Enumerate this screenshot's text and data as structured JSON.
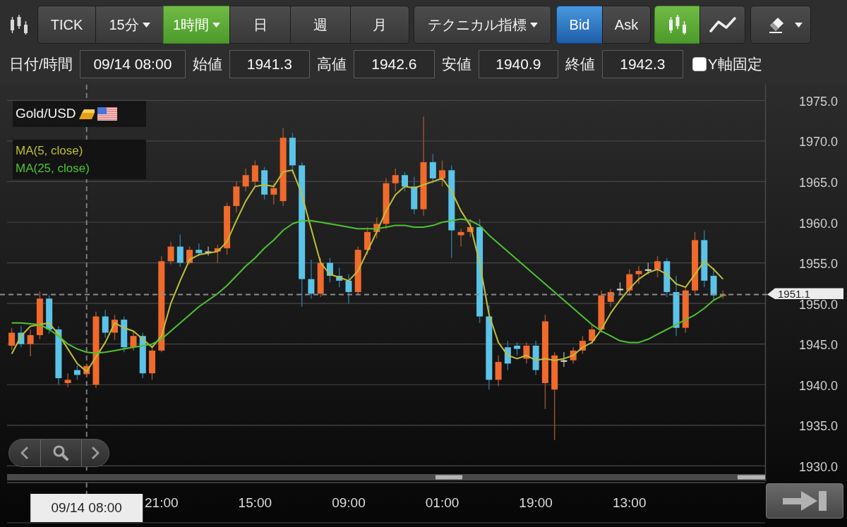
{
  "toolbar": {
    "periods": [
      {
        "label": "TICK",
        "selected": false,
        "dropdown": false
      },
      {
        "label": "15分",
        "selected": false,
        "dropdown": true
      },
      {
        "label": "1時間",
        "selected": true,
        "dropdown": true
      },
      {
        "label": "日",
        "selected": false,
        "dropdown": false
      },
      {
        "label": "週",
        "selected": false,
        "dropdown": false
      },
      {
        "label": "月",
        "selected": false,
        "dropdown": false
      }
    ],
    "indicator_menu": {
      "label": "テクニカル指標"
    },
    "price_sides": [
      {
        "label": "Bid",
        "selected": true
      },
      {
        "label": "Ask",
        "selected": false
      }
    ],
    "chart_types": [
      {
        "kind": "candlestick",
        "selected": true
      },
      {
        "kind": "line",
        "selected": false
      }
    ]
  },
  "ohlc_row": {
    "fields": [
      {
        "label": "日付/時間",
        "value": "09/14 08:00"
      },
      {
        "label": "始値",
        "value": "1941.3"
      },
      {
        "label": "高値",
        "value": "1942.6"
      },
      {
        "label": "安値",
        "value": "1940.9"
      },
      {
        "label": "終値",
        "value": "1942.3"
      }
    ],
    "y_axis_lock": {
      "label": "Y軸固定",
      "checked": false
    }
  },
  "chart": {
    "symbol": "Gold/USD",
    "crosshair_label": "09/14 08:00",
    "time_labels": [
      "21:00",
      "15:00",
      "09:00",
      "01:00",
      "19:00",
      "13:00"
    ],
    "chart_data": {
      "type": "candlestick",
      "grid": true,
      "ylim": [
        1930,
        1975
      ],
      "yticks": [
        {
          "value": 1975,
          "label": "1975.0"
        },
        {
          "value": 1970,
          "label": "1970.0"
        },
        {
          "value": 1965,
          "label": "1965.0"
        },
        {
          "value": 1960,
          "label": "1960.0"
        },
        {
          "value": 1955,
          "label": "1955.0"
        },
        {
          "value": 1950,
          "label": "1950.0"
        },
        {
          "value": 1945,
          "label": "1945.0"
        },
        {
          "value": 1940,
          "label": "1940.0"
        },
        {
          "value": 1935,
          "label": "1935.0"
        },
        {
          "value": 1930,
          "label": "1930.0"
        }
      ],
      "ohlc": [
        [
          1944.8,
          1947.0,
          1944.3,
          1946.4
        ],
        [
          1946.4,
          1947.2,
          1944.6,
          1945.0
        ],
        [
          1945.0,
          1946.8,
          1943.5,
          1946.1
        ],
        [
          1946.1,
          1951.5,
          1945.6,
          1950.6
        ],
        [
          1950.6,
          1951.0,
          1946.3,
          1946.8
        ],
        [
          1946.8,
          1947.2,
          1940.0,
          1940.8
        ],
        [
          1940.2,
          1941.4,
          1939.7,
          1940.6
        ],
        [
          1941.8,
          1942.4,
          1940.6,
          1941.2
        ],
        [
          1941.3,
          1942.6,
          1940.9,
          1942.3
        ],
        [
          1940.0,
          1949.0,
          1939.6,
          1948.4
        ],
        [
          1948.4,
          1949.2,
          1945.8,
          1946.4
        ],
        [
          1946.4,
          1948.6,
          1945.5,
          1948.0
        ],
        [
          1948.0,
          1948.4,
          1944.0,
          1944.6
        ],
        [
          1944.6,
          1946.6,
          1944.2,
          1946.0
        ],
        [
          1946.0,
          1946.4,
          1940.8,
          1941.4
        ],
        [
          1941.4,
          1944.8,
          1940.6,
          1944.2
        ],
        [
          1944.2,
          1955.8,
          1944.0,
          1955.2
        ],
        [
          1955.2,
          1957.6,
          1954.8,
          1957.0
        ],
        [
          1957.0,
          1958.5,
          1954.5,
          1955.0
        ],
        [
          1955.0,
          1957.0,
          1954.8,
          1956.6
        ],
        [
          1956.6,
          1957.4,
          1955.8,
          1956.2
        ],
        [
          1956.4,
          1957.0,
          1955.9,
          1956.4
        ],
        [
          1956.4,
          1957.2,
          1955.0,
          1956.8
        ],
        [
          1956.8,
          1962.4,
          1956.0,
          1962.0
        ],
        [
          1962.0,
          1965.0,
          1961.2,
          1964.4
        ],
        [
          1964.4,
          1966.6,
          1963.8,
          1965.8
        ],
        [
          1965.0,
          1967.6,
          1964.4,
          1967.0
        ],
        [
          1966.4,
          1966.8,
          1962.8,
          1963.4
        ],
        [
          1963.4,
          1964.8,
          1962.2,
          1964.2
        ],
        [
          1962.6,
          1971.6,
          1962.0,
          1970.4
        ],
        [
          1970.4,
          1971.0,
          1966.0,
          1967.0
        ],
        [
          1967.0,
          1967.4,
          1949.6,
          1953.0
        ],
        [
          1953.0,
          1955.4,
          1950.6,
          1951.2
        ],
        [
          1951.2,
          1955.6,
          1950.8,
          1955.0
        ],
        [
          1955.0,
          1955.6,
          1952.6,
          1953.4
        ],
        [
          1953.4,
          1954.4,
          1952.0,
          1952.8
        ],
        [
          1952.8,
          1953.6,
          1950.0,
          1951.4
        ],
        [
          1951.4,
          1957.0,
          1951.0,
          1956.6
        ],
        [
          1956.6,
          1959.4,
          1956.0,
          1958.8
        ],
        [
          1958.8,
          1960.6,
          1958.0,
          1959.8
        ],
        [
          1959.8,
          1965.4,
          1959.2,
          1964.8
        ],
        [
          1964.8,
          1966.6,
          1963.8,
          1965.8
        ],
        [
          1965.8,
          1966.2,
          1963.8,
          1964.4
        ],
        [
          1964.4,
          1965.6,
          1961.0,
          1961.6
        ],
        [
          1961.6,
          1973.0,
          1960.8,
          1967.4
        ],
        [
          1967.4,
          1968.4,
          1964.8,
          1965.4
        ],
        [
          1965.4,
          1967.6,
          1964.4,
          1966.4
        ],
        [
          1966.4,
          1967.0,
          1955.6,
          1959.0
        ],
        [
          1958.4,
          1959.2,
          1957.0,
          1958.8
        ],
        [
          1958.8,
          1960.4,
          1958.2,
          1959.4
        ],
        [
          1959.4,
          1960.4,
          1947.6,
          1948.4
        ],
        [
          1948.4,
          1949.8,
          1939.4,
          1940.6
        ],
        [
          1940.6,
          1943.6,
          1939.8,
          1942.8
        ],
        [
          1944.6,
          1945.4,
          1941.8,
          1942.6
        ],
        [
          1944.8,
          1945.2,
          1943.6,
          1944.4
        ],
        [
          1943.2,
          1945.2,
          1942.6,
          1944.8
        ],
        [
          1944.8,
          1945.4,
          1941.2,
          1941.8
        ],
        [
          1940.2,
          1948.6,
          1937.0,
          1947.8
        ],
        [
          1939.4,
          1944.0,
          1933.2,
          1943.6
        ],
        [
          1943.0,
          1944.0,
          1942.2,
          1943.0
        ],
        [
          1943.0,
          1944.6,
          1942.6,
          1944.2
        ],
        [
          1944.2,
          1946.0,
          1943.8,
          1945.4
        ],
        [
          1945.4,
          1947.4,
          1945.0,
          1946.8
        ],
        [
          1946.8,
          1951.6,
          1946.4,
          1951.0
        ],
        [
          1950.2,
          1951.8,
          1949.6,
          1951.4
        ],
        [
          1951.8,
          1952.6,
          1951.0,
          1951.8
        ],
        [
          1951.6,
          1954.2,
          1951.0,
          1953.6
        ],
        [
          1953.6,
          1954.6,
          1952.4,
          1954.0
        ],
        [
          1954.2,
          1955.0,
          1953.6,
          1954.2
        ],
        [
          1954.2,
          1955.8,
          1953.2,
          1955.2
        ],
        [
          1955.2,
          1955.6,
          1950.8,
          1951.4
        ],
        [
          1951.4,
          1953.4,
          1946.0,
          1947.0
        ],
        [
          1947.0,
          1952.0,
          1946.4,
          1951.6
        ],
        [
          1951.6,
          1958.8,
          1951.2,
          1957.8
        ],
        [
          1957.8,
          1959.0,
          1952.0,
          1952.8
        ],
        [
          1953.4,
          1954.4,
          1950.4,
          1951.0
        ],
        [
          1951.0,
          1951.6,
          1950.6,
          1951.1
        ],
        null,
        null,
        null,
        null
      ],
      "series": [
        {
          "name": "MA(5, close)",
          "type": "line",
          "color": "#bfbf36",
          "values": [
            1943.8,
            1946.0,
            1947.2,
            1947.4,
            1947.6,
            1946.2,
            1944.4,
            1942.6,
            1941.6,
            1943.4,
            1945.2,
            1947.6,
            1947.0,
            1946.6,
            1945.6,
            1944.6,
            1946.0,
            1950.0,
            1952.8,
            1955.4,
            1956.0,
            1956.2,
            1956.4,
            1957.6,
            1960.2,
            1962.6,
            1964.4,
            1964.6,
            1964.4,
            1966.2,
            1966.4,
            1963.4,
            1959.2,
            1955.0,
            1953.6,
            1953.2,
            1952.8,
            1954.0,
            1956.4,
            1958.8,
            1961.4,
            1963.4,
            1964.4,
            1964.2,
            1964.6,
            1965.0,
            1965.4,
            1963.8,
            1961.4,
            1959.6,
            1955.0,
            1948.6,
            1945.2,
            1943.6,
            1943.2,
            1943.6,
            1943.0,
            1943.2,
            1943.0,
            1943.2,
            1943.6,
            1944.6,
            1945.2,
            1946.8,
            1948.8,
            1950.4,
            1951.8,
            1953.0,
            1953.8,
            1954.2,
            1953.6,
            1952.4,
            1952.0,
            1953.6,
            1955.2,
            1954.2,
            1953.0,
            null,
            null,
            null,
            null
          ]
        },
        {
          "name": "MA(25, close)",
          "type": "line",
          "color": "#4fc232",
          "values": [
            1947.6,
            1947.6,
            1947.5,
            1947.4,
            1946.8,
            1946.0,
            1945.0,
            1944.4,
            1944.0,
            1943.9,
            1944.0,
            1944.2,
            1944.4,
            1944.6,
            1944.8,
            1945.0,
            1945.6,
            1946.6,
            1947.6,
            1948.6,
            1949.6,
            1950.4,
            1951.2,
            1952.2,
            1953.4,
            1954.6,
            1955.6,
            1956.8,
            1957.8,
            1959.0,
            1959.8,
            1960.2,
            1960.2,
            1960.0,
            1959.8,
            1959.6,
            1959.4,
            1959.2,
            1959.2,
            1959.2,
            1959.4,
            1959.6,
            1959.6,
            1959.4,
            1959.4,
            1959.6,
            1960.0,
            1960.2,
            1960.4,
            1960.2,
            1959.6,
            1958.4,
            1957.4,
            1956.4,
            1955.4,
            1954.4,
            1953.4,
            1952.4,
            1951.4,
            1950.4,
            1949.4,
            1948.4,
            1947.4,
            1946.6,
            1946.0,
            1945.4,
            1945.2,
            1945.2,
            1945.6,
            1946.2,
            1946.8,
            1947.4,
            1948.0,
            1948.6,
            1949.4,
            1950.4,
            1951.0,
            null,
            null,
            null,
            null
          ]
        }
      ],
      "ref_lines": [
        {
          "axis": "y",
          "value": 1951.1,
          "label": "1951.1"
        }
      ]
    }
  }
}
